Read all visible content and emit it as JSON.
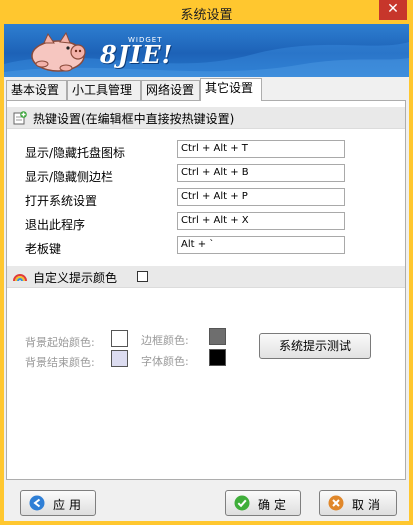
{
  "window": {
    "title": "系统设置",
    "close_glyph": "✕"
  },
  "banner": {
    "logo_text": "8JIE!",
    "logo_sub": "WIDGET"
  },
  "tabs": [
    {
      "label": "基本设置"
    },
    {
      "label": "小工具管理"
    },
    {
      "label": "网络设置"
    },
    {
      "label": "其它设置"
    }
  ],
  "active_tab": "其它设置",
  "hotkeys": {
    "section_title": "热键设置(在编辑框中直接按热键设置)",
    "section_icon": "add-note-icon",
    "rows": [
      {
        "label": "显示/隐藏托盘图标",
        "value": "Ctrl + Alt + T"
      },
      {
        "label": "显示/隐藏侧边栏",
        "value": "Ctrl + Alt + B"
      },
      {
        "label": "打开系统设置",
        "value": "Ctrl + Alt + P"
      },
      {
        "label": "退出此程序",
        "value": "Ctrl + Alt + X"
      },
      {
        "label": "老板键",
        "value": "Alt + `"
      }
    ]
  },
  "tips": {
    "section_title": "自定义提示颜色",
    "section_icon": "rainbow-icon",
    "checked": false,
    "bg_start_label": "背景起始颜色:",
    "bg_end_label": "背景结束颜色:",
    "border_label": "边框颜色:",
    "font_label": "字体颜色:",
    "bg_start_color": "#ffffff",
    "bg_end_color": "#dcdcf0",
    "border_color": "#6e6e6e",
    "font_color": "#000000",
    "test_button": "系统提示测试"
  },
  "footer": {
    "apply": "应用",
    "ok": "确定",
    "cancel": "取消"
  },
  "colors": {
    "titlebar": "#ffc72f",
    "close": "#c7362b",
    "banner": "#1d62b7"
  }
}
